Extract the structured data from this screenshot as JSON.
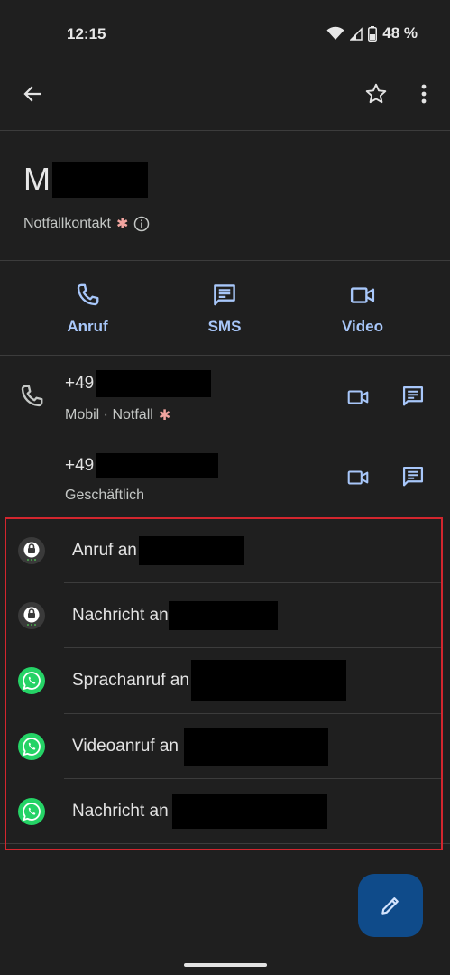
{
  "status_bar": {
    "time": "12:15",
    "battery": "48 %"
  },
  "top_bar": {
    "back_icon": "arrow-left-icon",
    "star_icon": "star-outline-icon",
    "more_icon": "more-vert-icon"
  },
  "contact": {
    "name_initial": "M",
    "emergency_label": "Notfallkontakt",
    "asterisk": "✱"
  },
  "actions": [
    {
      "label": "Anruf",
      "icon": "phone-icon"
    },
    {
      "label": "SMS",
      "icon": "message-icon"
    },
    {
      "label": "Video",
      "icon": "video-icon"
    }
  ],
  "phones": [
    {
      "number": "+49",
      "type": "Mobil · Notfall",
      "emergency": "✱"
    },
    {
      "number": "+49",
      "type": "Geschäftlich"
    }
  ],
  "apps": [
    {
      "label": "Anruf an",
      "icon": "signal-icon"
    },
    {
      "label": "Nachricht an",
      "icon": "signal-icon"
    },
    {
      "label": "Sprachanruf an",
      "icon": "whatsapp-icon"
    },
    {
      "label": "Videoanruf an",
      "icon": "whatsapp-icon"
    },
    {
      "label": "Nachricht an",
      "icon": "whatsapp-icon"
    }
  ],
  "colors": {
    "background": "#1f1f1f",
    "accent": "#a8c7fa",
    "fab": "#0f4b8a",
    "highlight_border": "#d3262e",
    "whatsapp": "#25d366"
  },
  "fab": {
    "icon": "edit-pencil-icon"
  }
}
